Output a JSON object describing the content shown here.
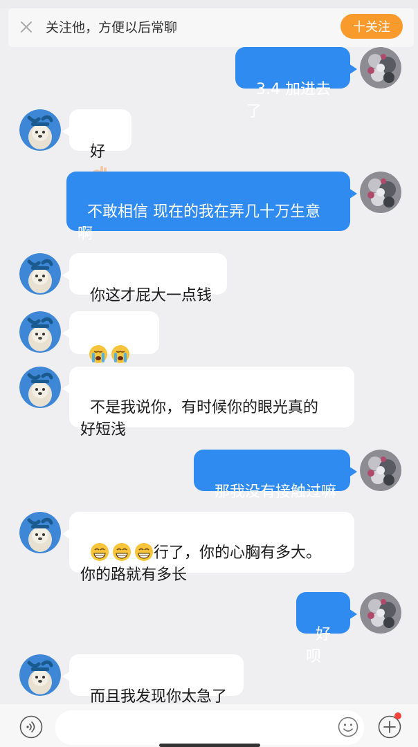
{
  "follow_bar": {
    "close_icon": "close-icon",
    "prompt_text": "关注他，方便以后常聊",
    "button_label": "十关注",
    "button_color": "#f89a2c"
  },
  "colors": {
    "outgoing_bubble": "#2f8bf0",
    "incoming_bubble": "#ffffff",
    "background": "#efeff1"
  },
  "messages": [
    {
      "side": "out",
      "text": "3.4 加进去了"
    },
    {
      "side": "in",
      "text": "好",
      "emoji": "ok-hand-emoji"
    },
    {
      "side": "out",
      "text": "不敢相信 现在的我在弄几十万生意\n啊"
    },
    {
      "side": "in",
      "text": "你这才屁大一点钱"
    },
    {
      "side": "in",
      "emojis": [
        "crying-face-emoji",
        "crying-face-emoji",
        "crying-face-emoji"
      ]
    },
    {
      "side": "in",
      "text": "不是我说你，有时候你的眼光真的\n好短浅"
    },
    {
      "side": "out",
      "text": "那我没有接触过嘛"
    },
    {
      "side": "in",
      "emojis_prefix": [
        "grinning-face-emoji",
        "grinning-face-emoji",
        "grinning-face-emoji"
      ],
      "text": "行了，你的心胸有多大。\n你的路就有多长"
    },
    {
      "side": "out",
      "text": "好呗"
    },
    {
      "side": "in",
      "text": "而且我发现你太急了"
    }
  ],
  "input_bar": {
    "voice_icon": "voice-icon",
    "emoji_icon": "smile-icon",
    "plus_icon": "plus-icon"
  }
}
